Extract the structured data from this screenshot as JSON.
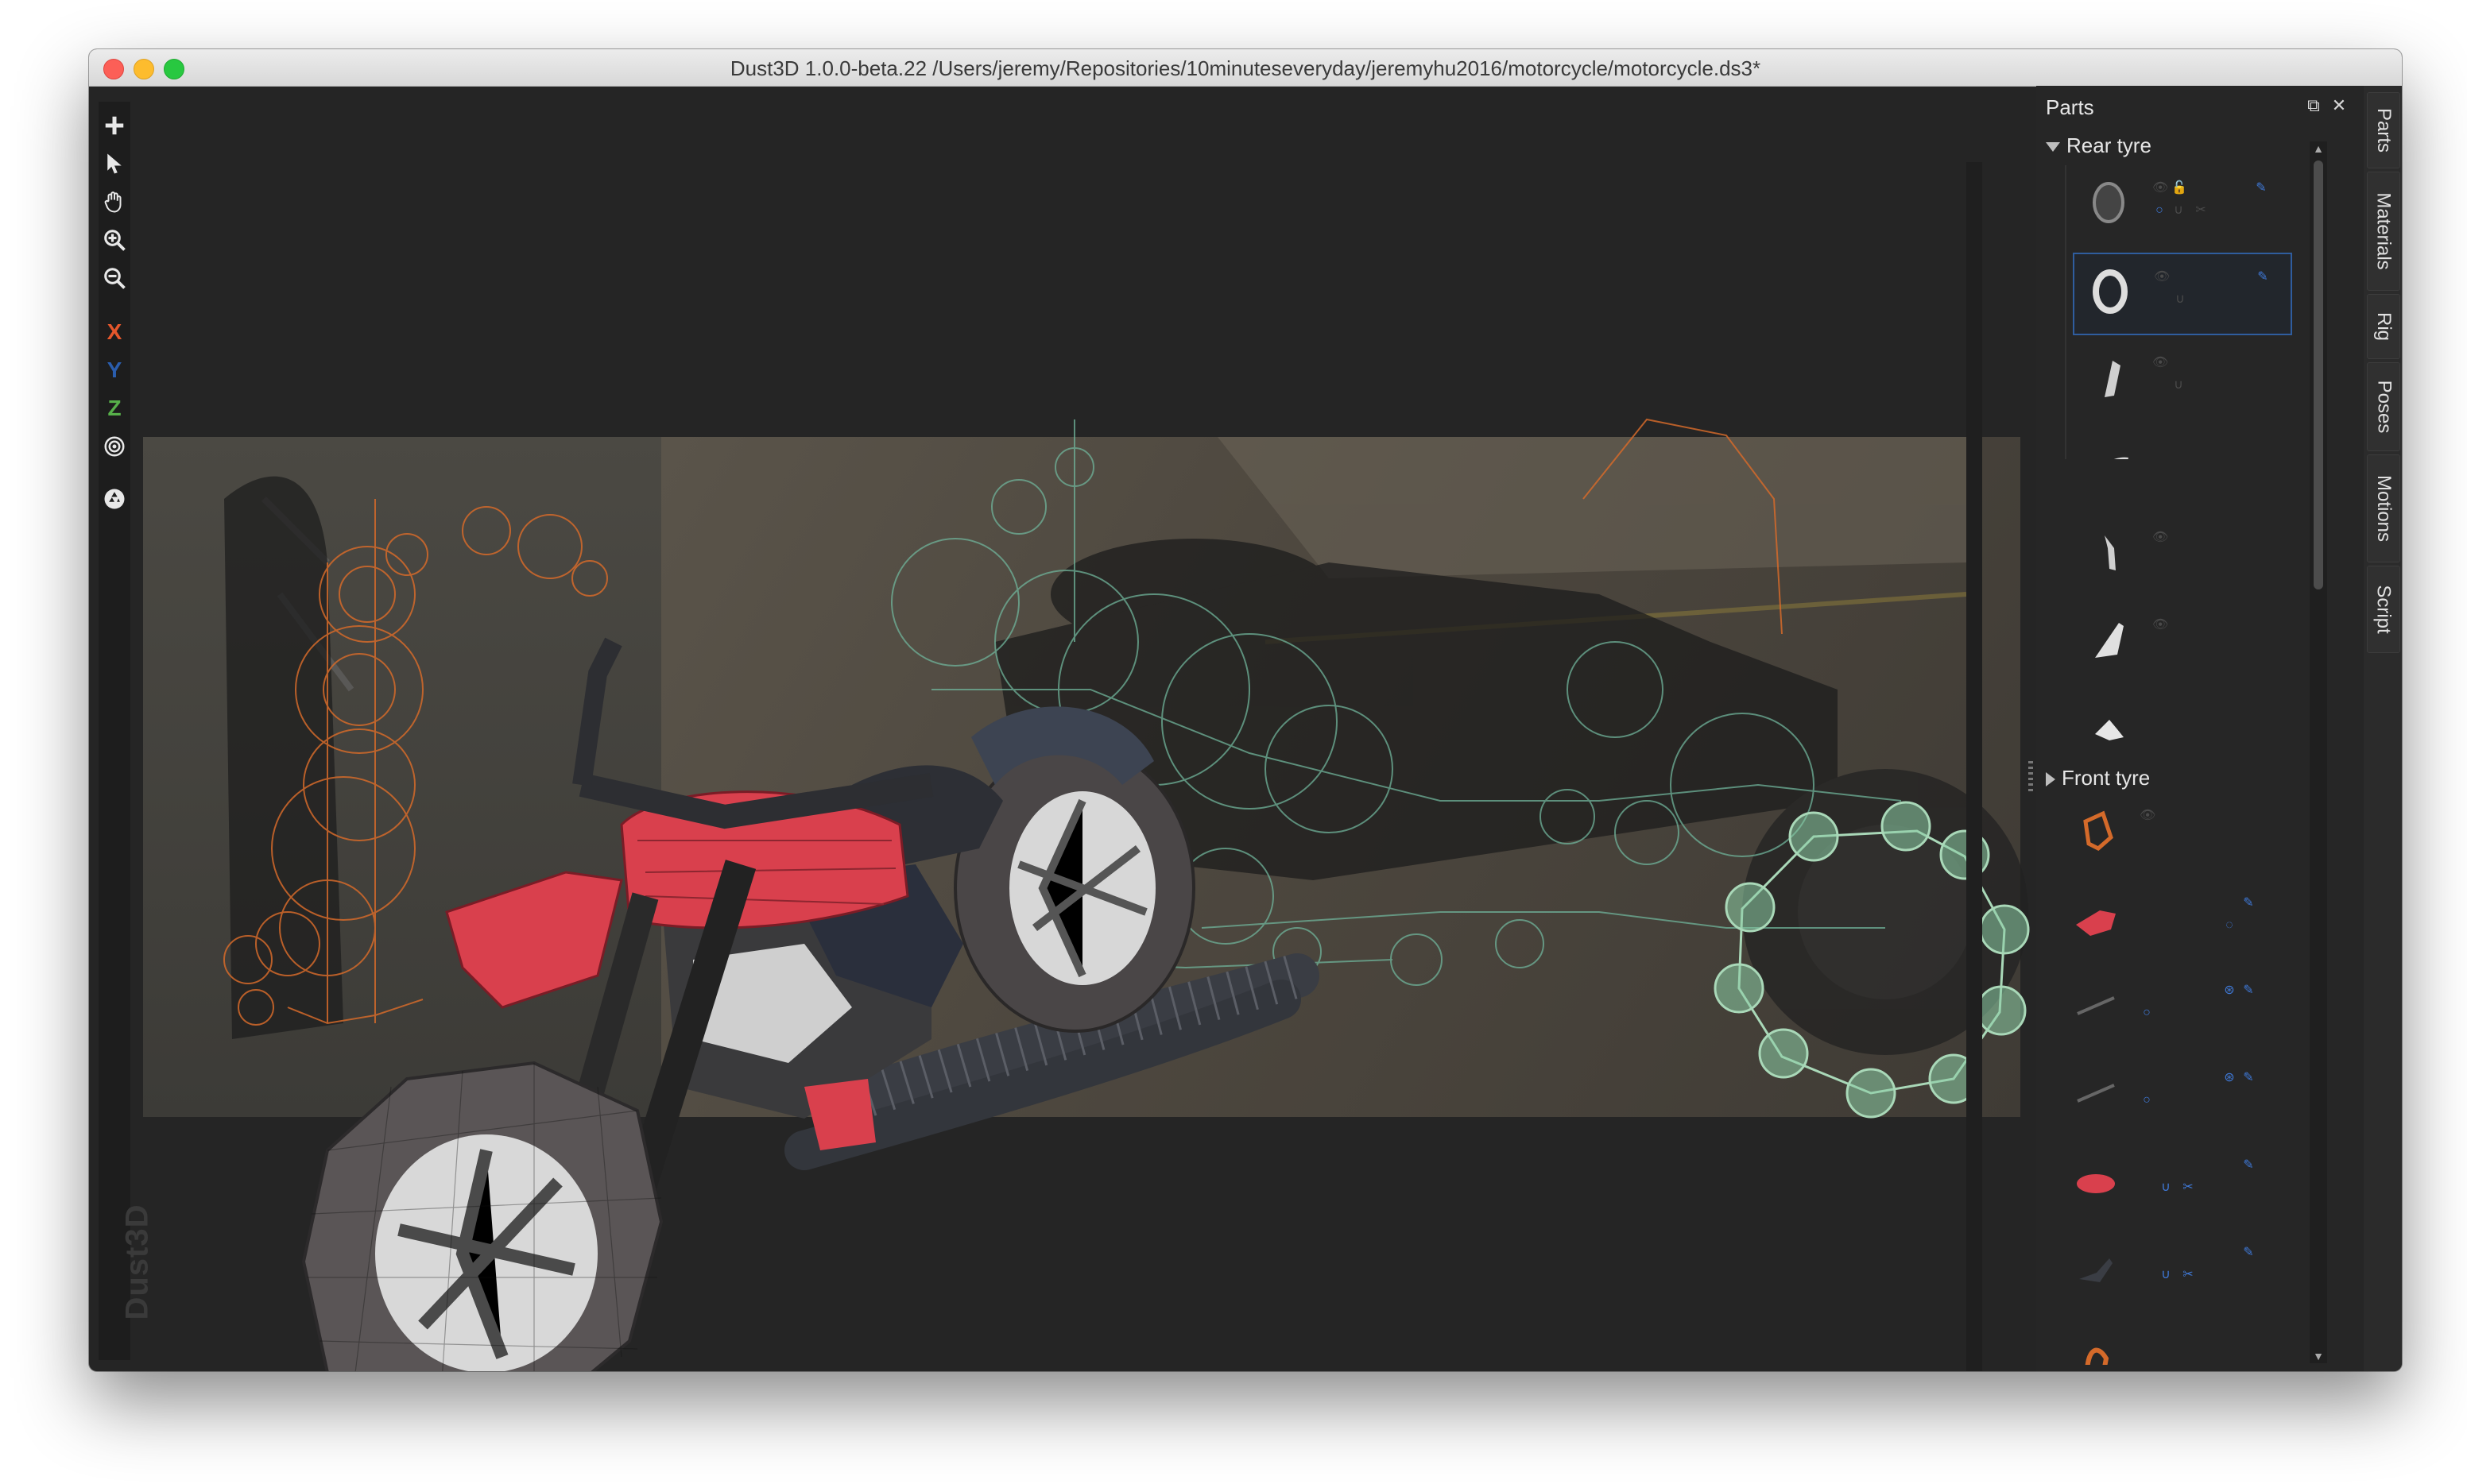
{
  "window": {
    "title": "Dust3D 1.0.0-beta.22 /Users/jeremy/Repositories/10minuteseveryday/jeremyhu2016/motorcycle/motorcycle.ds3*"
  },
  "toolbar": {
    "tools": [
      {
        "name": "add-icon"
      },
      {
        "name": "select-icon"
      },
      {
        "name": "drag-hand-icon"
      },
      {
        "name": "zoom-in-icon"
      },
      {
        "name": "zoom-out-icon"
      }
    ],
    "axes": [
      {
        "label": "X",
        "color": "#e5572c"
      },
      {
        "label": "Y",
        "color": "#2a5dad"
      },
      {
        "label": "Z",
        "color": "#57b04a"
      }
    ],
    "watermark": "Dust3D"
  },
  "parts_panel": {
    "title": "Parts",
    "groups": [
      {
        "label": "Rear tyre",
        "expanded": true
      },
      {
        "label": "Front tyre",
        "expanded": false
      }
    ]
  },
  "side_tabs": [
    "Parts",
    "Materials",
    "Rig",
    "Poses",
    "Motions",
    "Script"
  ]
}
